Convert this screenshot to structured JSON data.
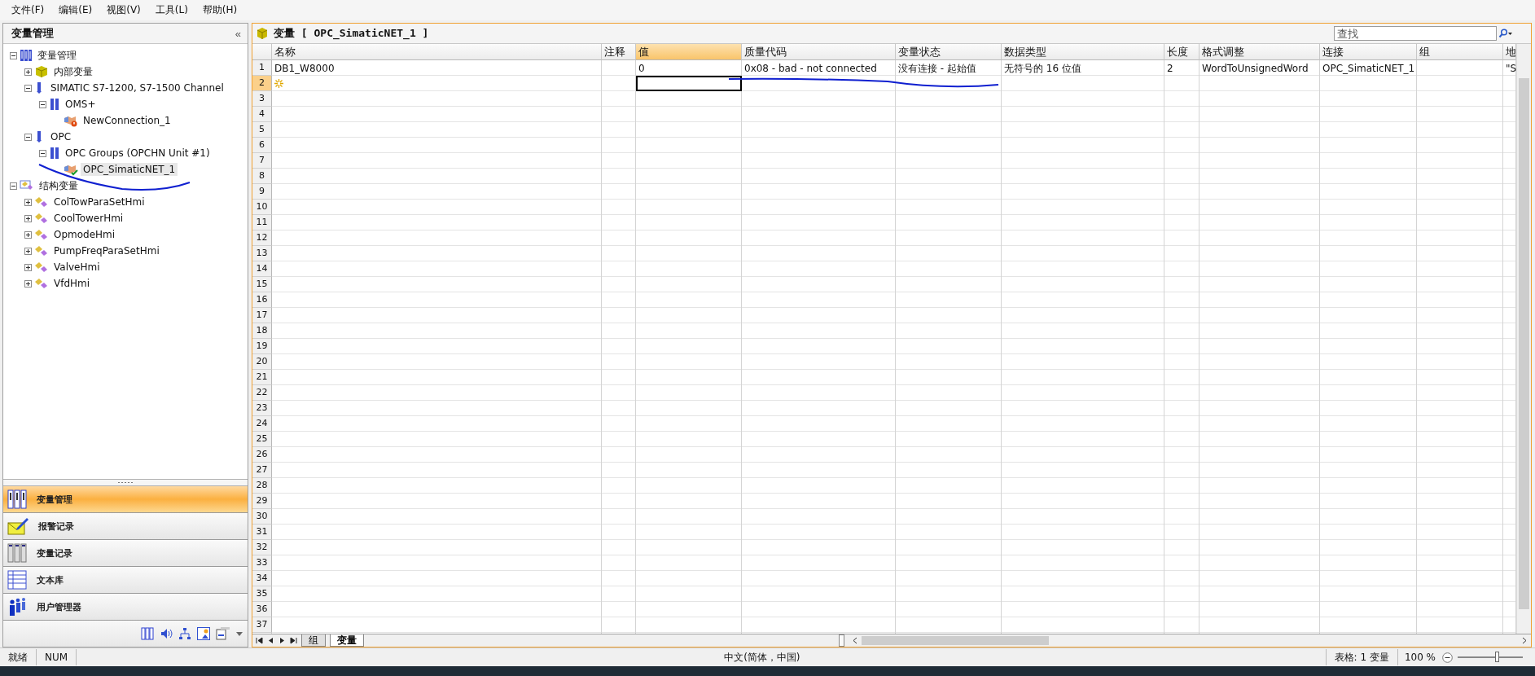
{
  "menu": [
    "文件(F)",
    "编辑(E)",
    "视图(V)",
    "工具(L)",
    "帮助(H)"
  ],
  "sidebar": {
    "title": "变量管理",
    "collapse": "«",
    "tree": [
      {
        "kind": "root",
        "label": "变量管理",
        "expanded": true,
        "selected": false,
        "children": [
          {
            "kind": "internal",
            "label": "内部变量",
            "expanded": false,
            "selected": false
          },
          {
            "kind": "channel",
            "label": "SIMATIC S7-1200, S7-1500 Channel",
            "expanded": true,
            "selected": false,
            "children": [
              {
                "kind": "group",
                "label": "OMS+",
                "expanded": true,
                "selected": false,
                "children": [
                  {
                    "kind": "connection-error",
                    "label": "NewConnection_1",
                    "selected": false
                  }
                ]
              }
            ]
          },
          {
            "kind": "channel",
            "label": "OPC",
            "expanded": true,
            "selected": false,
            "children": [
              {
                "kind": "group",
                "label": "OPC Groups (OPCHN Unit #1)",
                "expanded": true,
                "selected": false,
                "children": [
                  {
                    "kind": "connection-ok",
                    "label": "OPC_SimaticNET_1",
                    "selected": true
                  }
                ]
              }
            ]
          }
        ]
      },
      {
        "kind": "struct",
        "label": "结构变量",
        "expanded": true,
        "selected": false,
        "children": [
          {
            "kind": "struct-item",
            "label": "ColTowParaSetHmi",
            "expanded": false,
            "selected": false
          },
          {
            "kind": "struct-item",
            "label": "CoolTowerHmi",
            "expanded": false,
            "selected": false
          },
          {
            "kind": "struct-item",
            "label": "OpmodeHmi",
            "expanded": false,
            "selected": false
          },
          {
            "kind": "struct-item",
            "label": "PumpFreqParaSetHmi",
            "expanded": false,
            "selected": false
          },
          {
            "kind": "struct-item",
            "label": "ValveHmi",
            "expanded": false,
            "selected": false
          },
          {
            "kind": "struct-item",
            "label": "VfdHmi",
            "expanded": false,
            "selected": false
          }
        ]
      }
    ],
    "nav": [
      {
        "kind": "tags",
        "label": "变量管理",
        "selected": true
      },
      {
        "kind": "alarms",
        "label": "报警记录",
        "selected": false
      },
      {
        "kind": "logging",
        "label": "变量记录",
        "selected": false
      },
      {
        "kind": "text",
        "label": "文本库",
        "selected": false
      },
      {
        "kind": "users",
        "label": "用户管理器",
        "selected": false
      }
    ]
  },
  "editor": {
    "title": "变量 [ OPC_SimaticNET_1 ]",
    "search": {
      "placeholder": "查找"
    },
    "columns": [
      {
        "label": "名称",
        "selected": false
      },
      {
        "label": "注释",
        "selected": false
      },
      {
        "label": "值",
        "selected": true
      },
      {
        "label": "质量代码",
        "selected": false
      },
      {
        "label": "变量状态",
        "selected": false
      },
      {
        "label": "数据类型",
        "selected": false
      },
      {
        "label": "长度",
        "selected": false
      },
      {
        "label": "格式调整",
        "selected": false
      },
      {
        "label": "连接",
        "selected": false
      },
      {
        "label": "组",
        "selected": false
      },
      {
        "label": "地",
        "selected": false
      }
    ],
    "rows": [
      {
        "number": "1",
        "kind": "data",
        "selected": false,
        "cells": [
          "DB1_W8000",
          null,
          "0",
          "0x08 - bad - not connected",
          "没有连接 - 起始值",
          "无符号的 16 位值",
          "2",
          "WordToUnsignedWord",
          "OPC_SimaticNET_1",
          null,
          "\"S"
        ]
      },
      {
        "number": "2",
        "kind": "new",
        "selected": true
      },
      {
        "number": "3",
        "kind": "empty",
        "selected": false
      },
      {
        "number": "4",
        "kind": "empty",
        "selected": false
      },
      {
        "number": "5",
        "kind": "empty",
        "selected": false
      },
      {
        "number": "6",
        "kind": "empty",
        "selected": false
      },
      {
        "number": "7",
        "kind": "empty",
        "selected": false
      },
      {
        "number": "8",
        "kind": "empty",
        "selected": false
      },
      {
        "number": "9",
        "kind": "empty",
        "selected": false
      },
      {
        "number": "10",
        "kind": "empty",
        "selected": false
      },
      {
        "number": "11",
        "kind": "empty",
        "selected": false
      },
      {
        "number": "12",
        "kind": "empty",
        "selected": false
      },
      {
        "number": "13",
        "kind": "empty",
        "selected": false
      },
      {
        "number": "14",
        "kind": "empty",
        "selected": false
      },
      {
        "number": "15",
        "kind": "empty",
        "selected": false
      },
      {
        "number": "16",
        "kind": "empty",
        "selected": false
      },
      {
        "number": "17",
        "kind": "empty",
        "selected": false
      },
      {
        "number": "18",
        "kind": "empty",
        "selected": false
      },
      {
        "number": "19",
        "kind": "empty",
        "selected": false
      },
      {
        "number": "20",
        "kind": "empty",
        "selected": false
      },
      {
        "number": "21",
        "kind": "empty",
        "selected": false
      },
      {
        "number": "22",
        "kind": "empty",
        "selected": false
      },
      {
        "number": "23",
        "kind": "empty",
        "selected": false
      },
      {
        "number": "24",
        "kind": "empty",
        "selected": false
      },
      {
        "number": "25",
        "kind": "empty",
        "selected": false
      },
      {
        "number": "26",
        "kind": "empty",
        "selected": false
      },
      {
        "number": "27",
        "kind": "empty",
        "selected": false
      },
      {
        "number": "28",
        "kind": "empty",
        "selected": false
      },
      {
        "number": "29",
        "kind": "empty",
        "selected": false
      },
      {
        "number": "30",
        "kind": "empty",
        "selected": false
      },
      {
        "number": "31",
        "kind": "empty",
        "selected": false
      },
      {
        "number": "32",
        "kind": "empty",
        "selected": false
      },
      {
        "number": "33",
        "kind": "empty",
        "selected": false
      },
      {
        "number": "34",
        "kind": "empty",
        "selected": false
      },
      {
        "number": "35",
        "kind": "empty",
        "selected": false
      },
      {
        "number": "36",
        "kind": "empty",
        "selected": false
      },
      {
        "number": "37",
        "kind": "empty",
        "selected": false
      }
    ],
    "sheet_tabs": [
      {
        "label": "组",
        "selected": false
      },
      {
        "label": "变量",
        "selected": true
      }
    ]
  },
  "status_bar": {
    "state": "就绪",
    "num_lock": "NUM",
    "language": "中文(简体，中国)",
    "table_info": "表格: 1 变量",
    "zoom": "100 %",
    "zoom_slider": {
      "level": 0.6
    }
  }
}
